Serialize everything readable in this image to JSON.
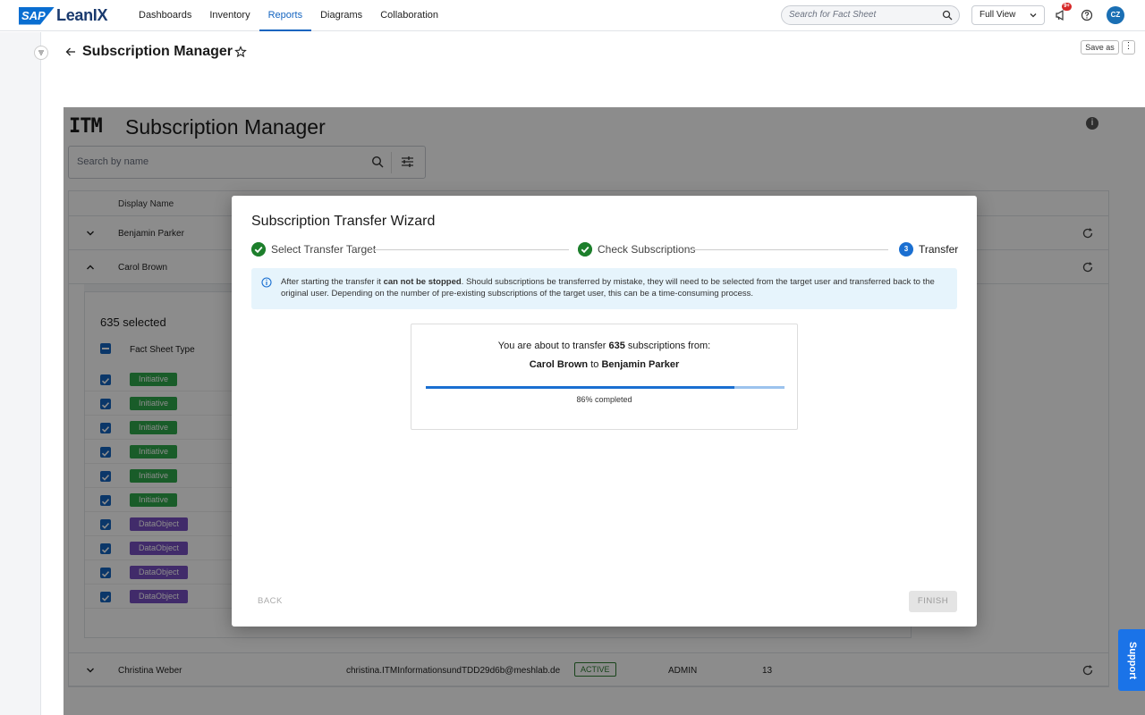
{
  "app": {
    "brand_sap": "SAP",
    "brand_name": "LeanIX"
  },
  "nav": {
    "items": [
      {
        "label": "Dashboards"
      },
      {
        "label": "Inventory"
      },
      {
        "label": "Reports"
      },
      {
        "label": "Diagrams"
      },
      {
        "label": "Collaboration"
      }
    ],
    "active": "Reports"
  },
  "search": {
    "placeholder": "Search for Fact Sheet"
  },
  "view_selector": {
    "value": "Full View"
  },
  "notifications": {
    "badge": "9+"
  },
  "user": {
    "initials": "CZ"
  },
  "page": {
    "title": "Subscription Manager",
    "save_as": "Save as",
    "more": "⋮"
  },
  "report": {
    "logo": "ITM",
    "title": "Subscription Manager",
    "search_placeholder": "Search by name",
    "columns": {
      "display_name": "Display Name"
    },
    "rows": [
      {
        "name": "Benjamin Parker"
      },
      {
        "name": "Carol Brown"
      },
      {
        "name": "Christina Weber",
        "email": "christina.ITMInformationsundTDD29d6b@meshlab.de",
        "status": "ACTIVE",
        "role": "ADMIN",
        "count": "13"
      }
    ],
    "expanded": {
      "selected": "635 selected",
      "column": "Fact Sheet Type",
      "items": [
        "Initiative",
        "Initiative",
        "Initiative",
        "Initiative",
        "Initiative",
        "Initiative",
        "DataObject",
        "DataObject",
        "DataObject",
        "DataObject"
      ]
    }
  },
  "wizard": {
    "title": "Subscription Transfer Wizard",
    "steps": [
      {
        "label": "Select Transfer Target"
      },
      {
        "label": "Check Subscriptions"
      },
      {
        "label": "Transfer",
        "number": "3"
      }
    ],
    "alert": {
      "pre": "After starting the transfer it ",
      "bold": "can not be stopped",
      "post": ". Should subscriptions be transferred by mistake, they will need to be selected from the target user and transferred back to the original user. Depending on the number of pre-existing subscriptions of the target user, this can be a time-consuming process."
    },
    "transfer": {
      "line1_pre": "You are about to transfer ",
      "count": "635",
      "line1_post": " subscriptions from:",
      "from": "Carol Brown",
      "to_word": " to ",
      "to": "Benjamin Parker",
      "progress": 86,
      "progress_text": "86% completed"
    },
    "back_label": "BACK",
    "finish_label": "FINISH"
  },
  "support": {
    "label": "Support"
  },
  "colors": {
    "accent": "#1565c0",
    "initiative": "#2ea84b",
    "dataobject": "#774fc1",
    "done": "#1d7f2c"
  }
}
